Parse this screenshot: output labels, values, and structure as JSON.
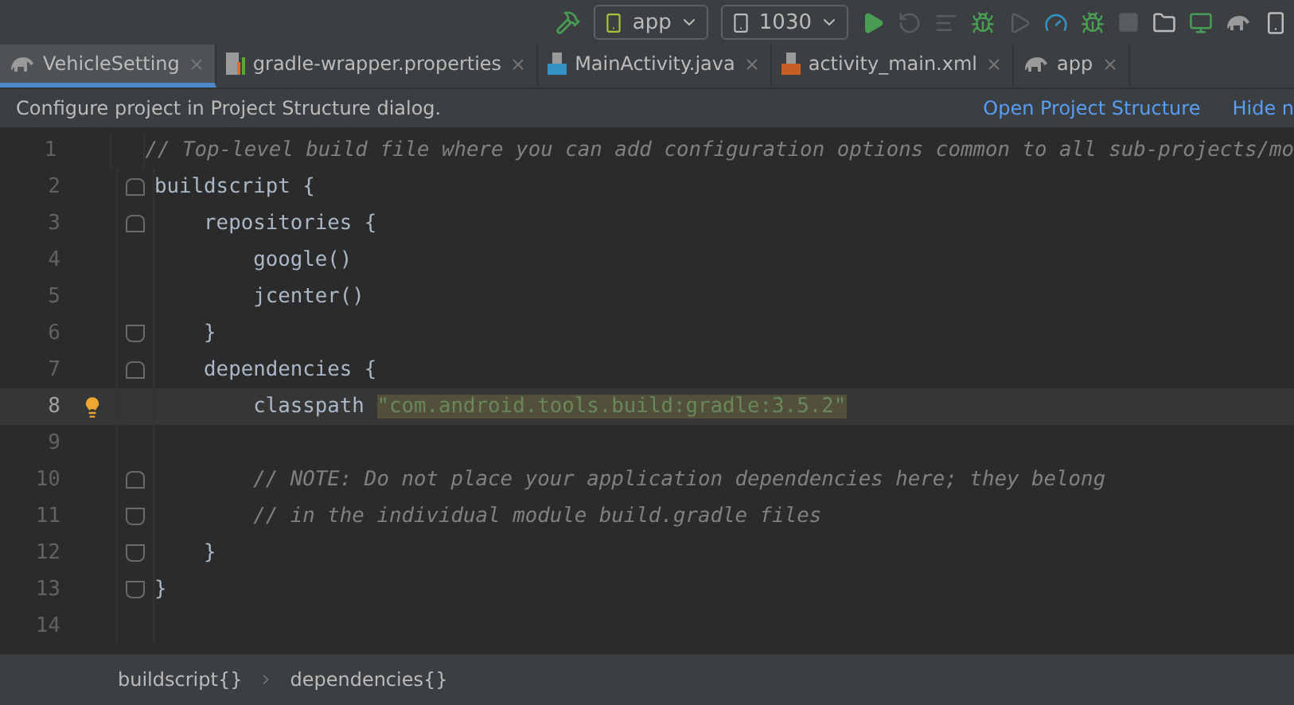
{
  "toolbar": {
    "run_config": "app",
    "device": "1030"
  },
  "tabs": [
    {
      "label": "VehicleSetting",
      "selected": true,
      "kind": "gradle"
    },
    {
      "label": "gradle-wrapper.properties",
      "selected": false,
      "kind": "properties"
    },
    {
      "label": "MainActivity.java",
      "selected": false,
      "kind": "java"
    },
    {
      "label": "activity_main.xml",
      "selected": false,
      "kind": "xml"
    },
    {
      "label": "app",
      "selected": false,
      "kind": "gradle"
    }
  ],
  "notification": {
    "message": "Configure project in Project Structure dialog.",
    "actions": [
      "Open Project Structure",
      "Hide n"
    ]
  },
  "lines": [
    {
      "number": "1",
      "fold_start": false,
      "fold_end": false,
      "current": false,
      "bulb": false,
      "tokens": [
        {
          "kind": "comment",
          "text": "// Top-level build file where you can add configuration options common to all sub-projects/mo"
        }
      ]
    },
    {
      "number": "2",
      "fold_start": true,
      "fold_end": false,
      "current": false,
      "bulb": false,
      "tokens": [
        {
          "kind": "plain",
          "text": "buildscript {"
        }
      ]
    },
    {
      "number": "3",
      "fold_start": true,
      "fold_end": false,
      "current": false,
      "bulb": false,
      "tokens": [
        {
          "kind": "plain",
          "text": "    repositories {"
        }
      ]
    },
    {
      "number": "4",
      "fold_start": false,
      "fold_end": false,
      "current": false,
      "bulb": false,
      "tokens": [
        {
          "kind": "plain",
          "text": "        google()"
        }
      ]
    },
    {
      "number": "5",
      "fold_start": false,
      "fold_end": false,
      "current": false,
      "bulb": false,
      "tokens": [
        {
          "kind": "plain",
          "text": "        jcenter()"
        }
      ]
    },
    {
      "number": "6",
      "fold_start": false,
      "fold_end": true,
      "current": false,
      "bulb": false,
      "tokens": [
        {
          "kind": "plain",
          "text": "    }"
        }
      ]
    },
    {
      "number": "7",
      "fold_start": true,
      "fold_end": false,
      "current": false,
      "bulb": false,
      "tokens": [
        {
          "kind": "plain",
          "text": "    dependencies {"
        }
      ]
    },
    {
      "number": "8",
      "fold_start": false,
      "fold_end": false,
      "current": true,
      "bulb": true,
      "tokens": [
        {
          "kind": "plain",
          "text": "        classpath "
        },
        {
          "kind": "string",
          "text": "\"com.android.tools.build:gradle:3.5.2\""
        }
      ]
    },
    {
      "number": "9",
      "fold_start": false,
      "fold_end": false,
      "current": false,
      "bulb": false
    },
    {
      "number": "10",
      "fold_start": true,
      "fold_end": false,
      "current": false,
      "bulb": false,
      "tokens": [
        {
          "kind": "comment",
          "text": "        // NOTE: Do not place your application dependencies here; they belong"
        }
      ]
    },
    {
      "number": "11",
      "fold_start": false,
      "fold_end": true,
      "current": false,
      "bulb": false,
      "tokens": [
        {
          "kind": "comment",
          "text": "        // in the individual module build.gradle files"
        }
      ]
    },
    {
      "number": "12",
      "fold_start": false,
      "fold_end": true,
      "current": false,
      "bulb": false,
      "tokens": [
        {
          "kind": "plain",
          "text": "    }"
        }
      ]
    },
    {
      "number": "13",
      "fold_start": false,
      "fold_end": true,
      "current": false,
      "bulb": false,
      "tokens": [
        {
          "kind": "plain",
          "text": "}"
        }
      ]
    },
    {
      "number": "14",
      "fold_start": false,
      "fold_end": false,
      "current": false,
      "bulb": false
    }
  ],
  "breadcrumbs": [
    "buildscript{}",
    "dependencies{}"
  ]
}
